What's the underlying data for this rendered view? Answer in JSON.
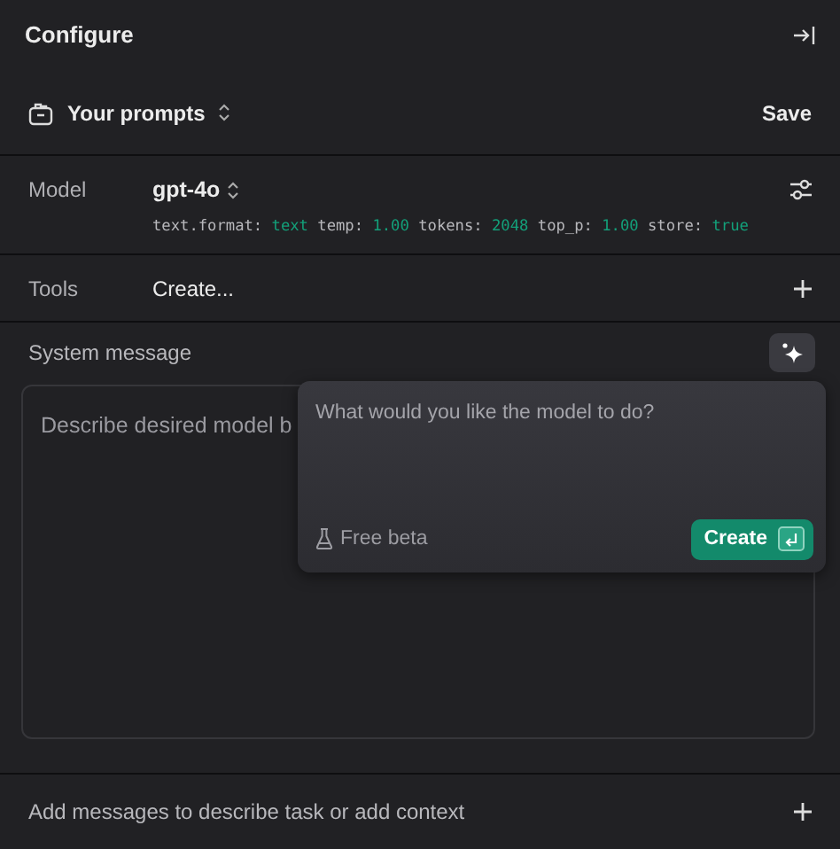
{
  "header": {
    "title": "Configure"
  },
  "prompts": {
    "label": "Your prompts",
    "save": "Save"
  },
  "model": {
    "label": "Model",
    "name": "gpt-4o",
    "params": [
      {
        "key": "text.format:",
        "value": "text"
      },
      {
        "key": "temp:",
        "value": "1.00"
      },
      {
        "key": "tokens:",
        "value": "2048"
      },
      {
        "key": "top_p:",
        "value": "1.00"
      },
      {
        "key": "store:",
        "value": "true"
      }
    ]
  },
  "tools": {
    "label": "Tools",
    "action": "Create..."
  },
  "system_message": {
    "label": "System message",
    "placeholder": "Describe desired model b"
  },
  "popover": {
    "placeholder": "What would you like the model to do?",
    "badge": "Free beta",
    "button": "Create"
  },
  "messages": {
    "label": "Add messages to describe task or add context"
  }
}
